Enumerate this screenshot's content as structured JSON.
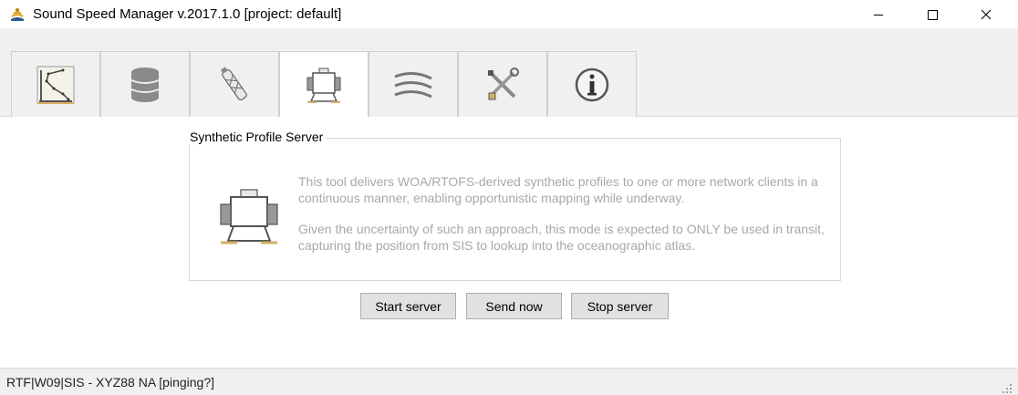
{
  "window": {
    "title": "Sound Speed Manager v.2017.1.0 [project: default]",
    "icon": "sound-speed-app-icon"
  },
  "tabs": [
    {
      "name": "profile-editor",
      "icon": "profile-plot-icon",
      "selected": false
    },
    {
      "name": "database",
      "icon": "database-icon",
      "selected": false
    },
    {
      "name": "sensor",
      "icon": "probe-icon",
      "selected": false
    },
    {
      "name": "server",
      "icon": "robot-server-icon",
      "selected": true
    },
    {
      "name": "refraction",
      "icon": "wave-lines-icon",
      "selected": false
    },
    {
      "name": "settings",
      "icon": "tools-icon",
      "selected": false
    },
    {
      "name": "info",
      "icon": "info-icon",
      "selected": false
    }
  ],
  "server_panel": {
    "group_title": "Synthetic Profile Server",
    "description_1": "This tool delivers WOA/RTOFS-derived synthetic profiles to one or more network clients in a continuous manner, enabling opportunistic mapping while underway.",
    "description_2": "Given the uncertainty of such an approach, this mode is expected to ONLY be used in transit, capturing the position from SIS to lookup into the oceanographic atlas."
  },
  "buttons": {
    "start": "Start server",
    "send": "Send now",
    "stop": "Stop server"
  },
  "status": {
    "text": "RTF|W09|SIS  -  XYZ88 NA [pinging?]"
  },
  "colors": {
    "description_text": "#a8a8a8",
    "content_bg": "#ffffff",
    "chrome_bg": "#f0f0f0"
  }
}
